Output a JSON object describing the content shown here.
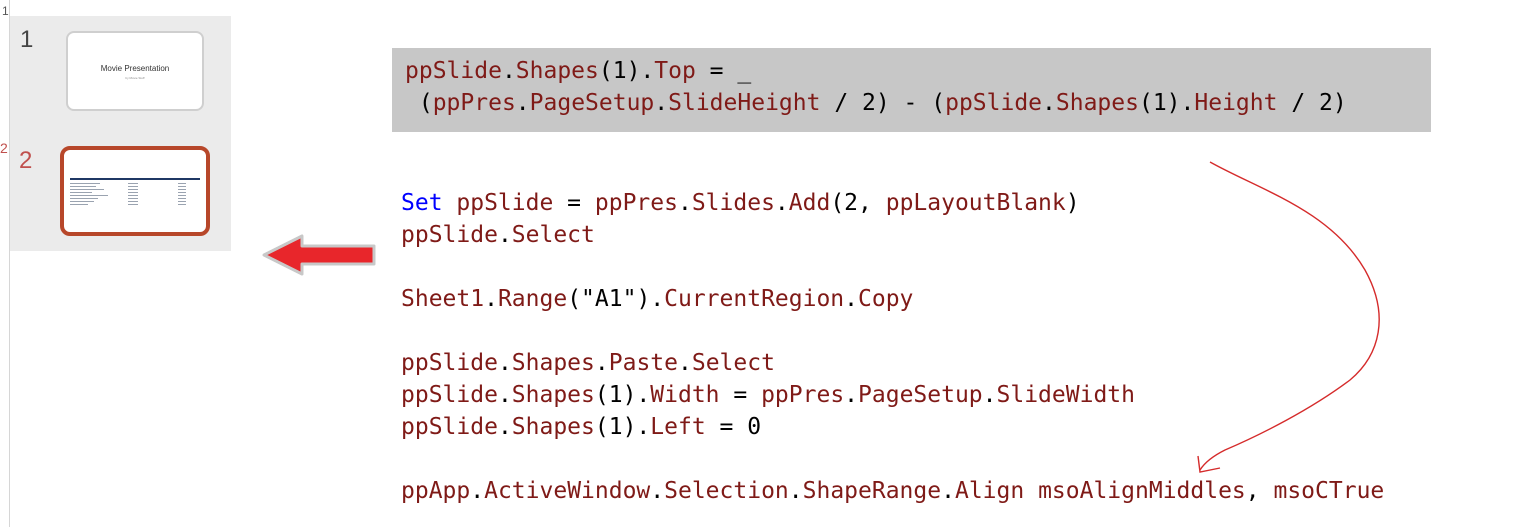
{
  "thumbnails": {
    "slide1": {
      "number": "1",
      "title": "Movie Presentation",
      "subtitle": "by Movie Stuff"
    },
    "slide2": {
      "number": "2"
    }
  },
  "edge": {
    "mark": "2",
    "tick": "1"
  },
  "highlight_code": {
    "line1": {
      "a": "ppSlide",
      "b": ".",
      "c": "Shapes",
      "d": "(1).",
      "e": "Top",
      "f": " = _"
    },
    "line2": {
      "a": " (",
      "b": "ppPres",
      "c": ".",
      "d": "PageSetup",
      "e": ".",
      "f": "SlideHeight",
      "g": " / 2) - (",
      "h": "ppSlide",
      "i": ".",
      "j": "Shapes",
      "k": "(1).",
      "l": "Height",
      "m": " / 2)"
    }
  },
  "code": {
    "l1": {
      "kw": "Set",
      "a": " ppSlide",
      "b": " = ",
      "c": "ppPres",
      "d": ".",
      "e": "Slides",
      "f": ".",
      "g": "Add",
      "h": "(2, ",
      "i": "ppLayoutBlank",
      "j": ")"
    },
    "l2": {
      "a": "ppSlide",
      "b": ".",
      "c": "Select"
    },
    "l3": {
      "a": "Sheet1",
      "b": ".",
      "c": "Range",
      "d": "(\"A1\").",
      "e": "CurrentRegion",
      "f": ".",
      "g": "Copy"
    },
    "l4": {
      "a": "ppSlide",
      "b": ".",
      "c": "Shapes",
      "d": ".",
      "e": "Paste",
      "f": ".",
      "g": "Select"
    },
    "l5": {
      "a": "ppSlide",
      "b": ".",
      "c": "Shapes",
      "d": "(1).",
      "e": "Width",
      "f": " = ",
      "g": "ppPres",
      "h": ".",
      "i": "PageSetup",
      "j": ".",
      "k": "SlideWidth"
    },
    "l6": {
      "a": "ppSlide",
      "b": ".",
      "c": "Shapes",
      "d": "(1).",
      "e": "Left",
      "f": " = 0"
    },
    "l7": {
      "a": "ppApp",
      "b": ".",
      "c": "ActiveWindow",
      "d": ".",
      "e": "Selection",
      "f": ".",
      "g": "ShapeRange",
      "h": ".",
      "i": "Align",
      "j": " msoAlignMiddles",
      "k": ", ",
      "l": "msoCTrue"
    }
  },
  "colors": {
    "identifier": "#7f1a17",
    "keyword": "#0000ff",
    "accent": "#b7472a",
    "arrow": "#e8262b"
  },
  "icons": {
    "left_arrow": "arrow-left-icon",
    "curved_arrow": "curved-arrow-icon"
  }
}
